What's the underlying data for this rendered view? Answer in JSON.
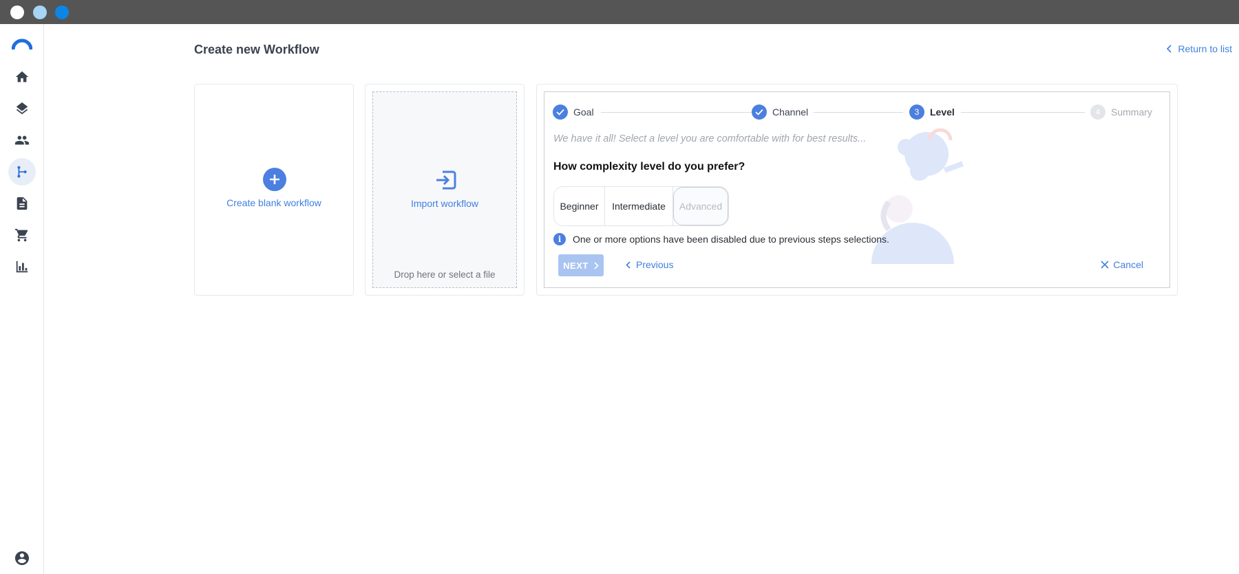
{
  "window": {
    "controls": [
      "close",
      "minimize",
      "maximize"
    ]
  },
  "sidebar": {
    "logo": "app-logo",
    "items": [
      {
        "icon": "home-icon",
        "active": false
      },
      {
        "icon": "layers-icon",
        "active": false
      },
      {
        "icon": "people-icon",
        "active": false
      },
      {
        "icon": "workflow-icon",
        "active": true
      },
      {
        "icon": "document-icon",
        "active": false
      },
      {
        "icon": "cart-icon",
        "active": false
      },
      {
        "icon": "bar-chart-icon",
        "active": false
      }
    ],
    "profile_icon": "account-circle-icon"
  },
  "header": {
    "title": "Create new Workflow",
    "return_label": "Return to list"
  },
  "cards": {
    "blank": {
      "label": "Create blank workflow"
    },
    "import": {
      "label": "Import workflow",
      "hint": "Drop here or select a file"
    }
  },
  "wizard": {
    "steps": [
      {
        "label": "Goal",
        "state": "done"
      },
      {
        "label": "Channel",
        "state": "done"
      },
      {
        "number": "3",
        "label": "Level",
        "state": "current"
      },
      {
        "number": "4",
        "label": "Summary",
        "state": "pending"
      }
    ],
    "subtitle": "We have it all! Select a level you are comfortable with for best results...",
    "question": "How complexity level do you prefer?",
    "options": [
      {
        "label": "Beginner",
        "disabled": false
      },
      {
        "label": "Intermediate",
        "disabled": false
      },
      {
        "label": "Advanced",
        "disabled": true
      }
    ],
    "info_text": "One or more options have been disabled due to previous steps selections.",
    "next_label": "NEXT",
    "previous_label": "Previous",
    "cancel_label": "Cancel"
  },
  "colors": {
    "accent": "#4b7fe0",
    "link": "#3f7fe0",
    "titlebar": "#555555"
  }
}
